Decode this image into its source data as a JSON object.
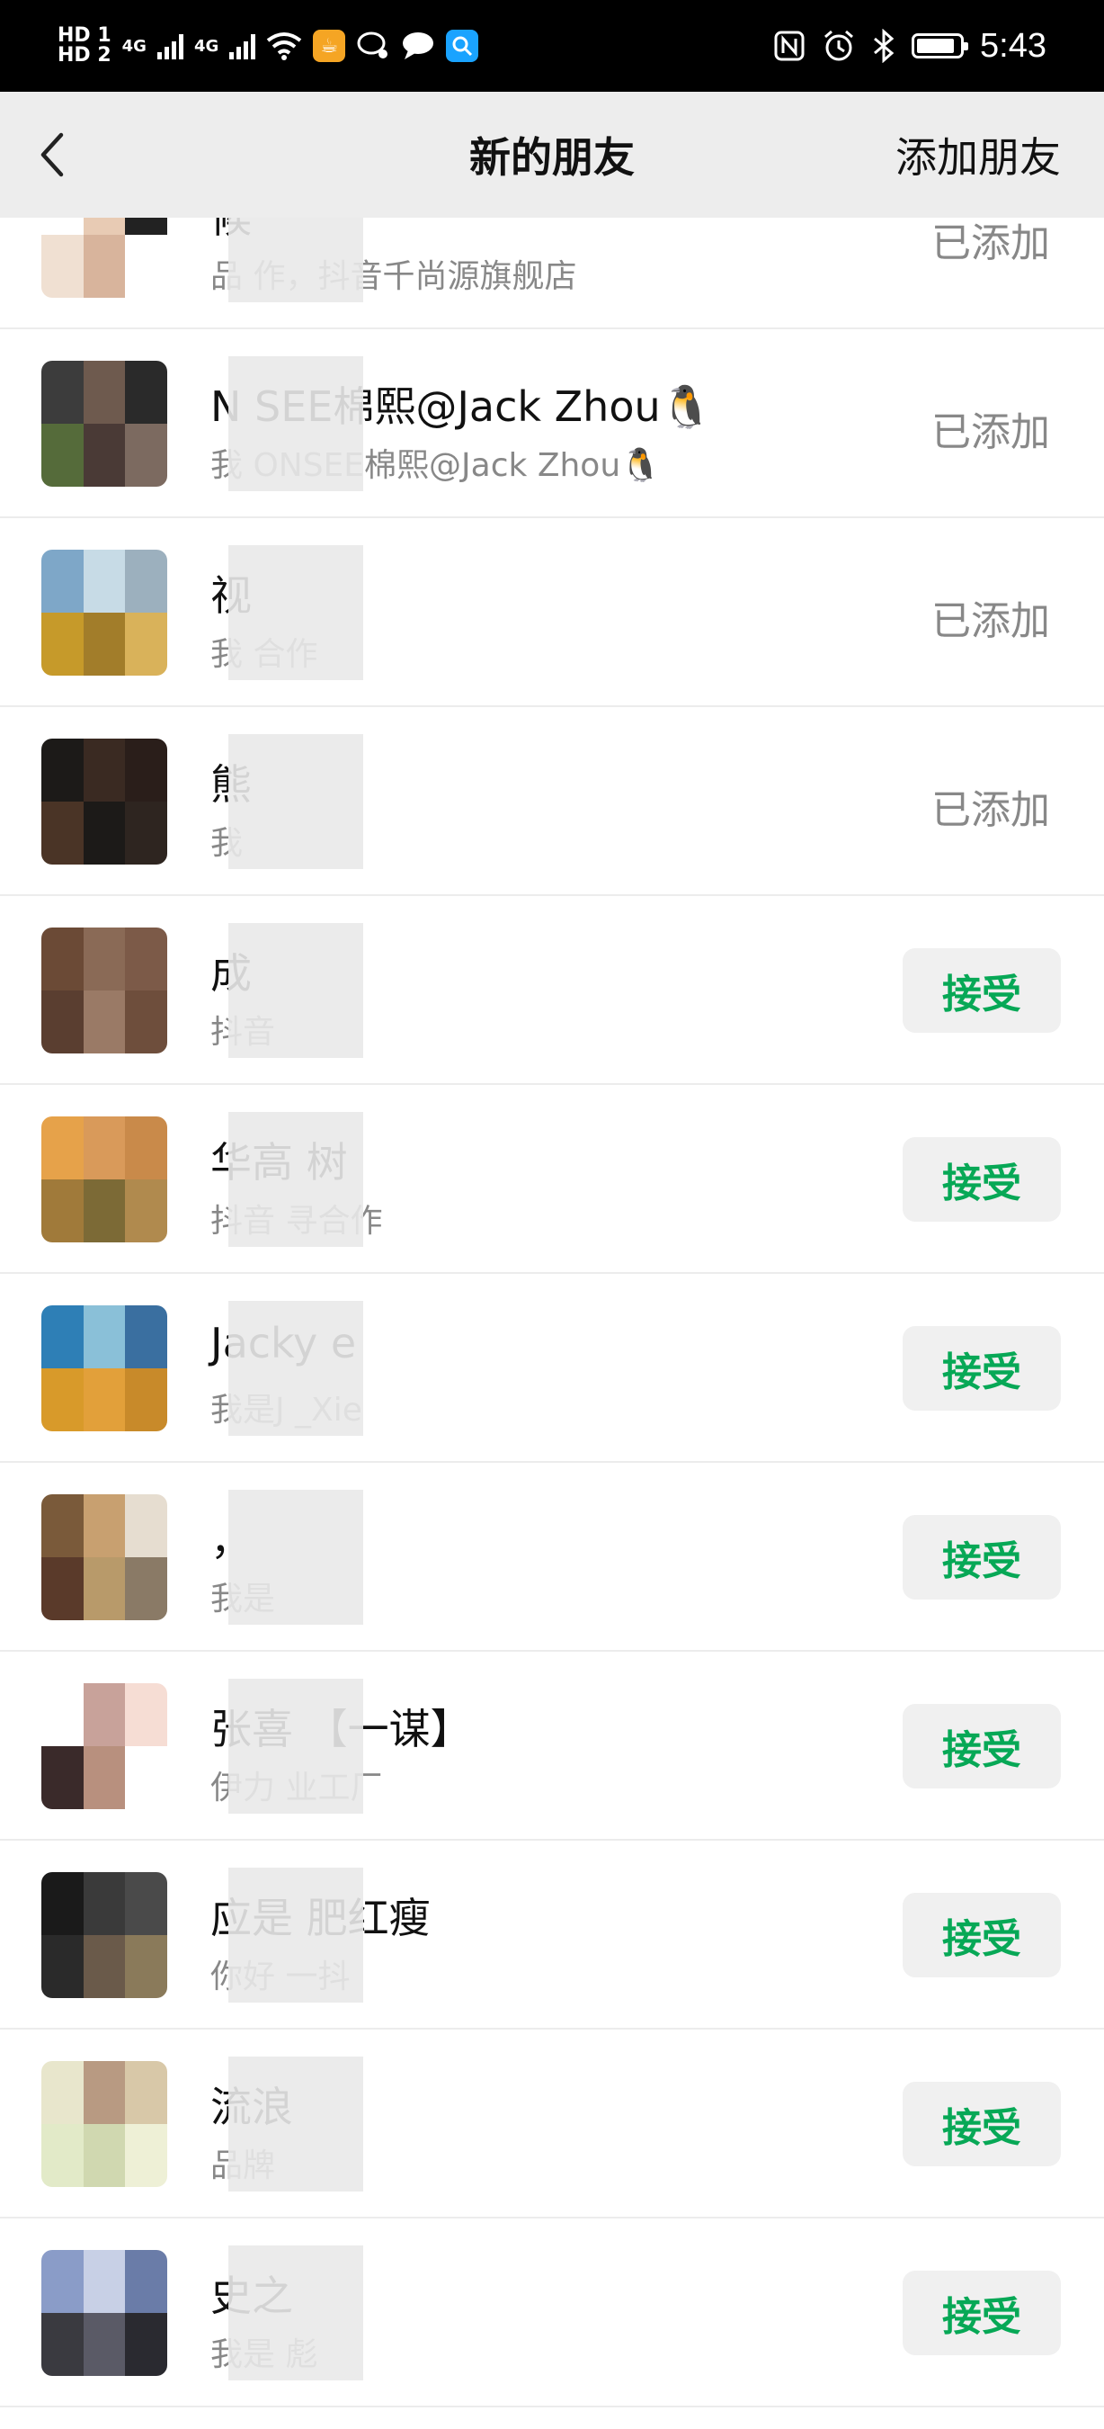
{
  "status_bar": {
    "hd1": "HD 1",
    "hd2": "HD 2",
    "net1": "4G",
    "net2": "4G",
    "time": "5:43",
    "battery_level": 0.9
  },
  "header": {
    "title": "新的朋友",
    "add_friends": "添加朋友"
  },
  "colors": {
    "accent": "#07a856",
    "header_bg": "#ededed",
    "status_bg": "#000000"
  },
  "requests": [
    {
      "name": "候",
      "message": "品 作，抖音千尚源旗舰店",
      "status": "已添加"
    },
    {
      "name": "N SEE棉熙@Jack Zhou🐧",
      "message": "我 ONSEE棉熙@Jack Zhou🐧",
      "status": "已添加"
    },
    {
      "name": "视",
      "message": "我 合作",
      "status": "已添加"
    },
    {
      "name": "熊",
      "message": "我",
      "status": "已添加"
    },
    {
      "name": "成",
      "message": "抖音",
      "status": "接受"
    },
    {
      "name": "华高 树",
      "message": "抖音 寻合作",
      "status": "接受"
    },
    {
      "name": "Jacky e",
      "message": "我是J _Xie",
      "status": "接受"
    },
    {
      "name": "，",
      "message": "我是",
      "status": "接受"
    },
    {
      "name": "张喜 【一谋】",
      "message": "伊力 业工厂",
      "status": "接受"
    },
    {
      "name": "应是 肥红瘦",
      "message": "你好 一抖",
      "status": "接受"
    },
    {
      "name": "流浪",
      "message": "品牌",
      "status": "接受"
    },
    {
      "name": "史之",
      "message": "我是 彪",
      "status": "接受"
    }
  ]
}
